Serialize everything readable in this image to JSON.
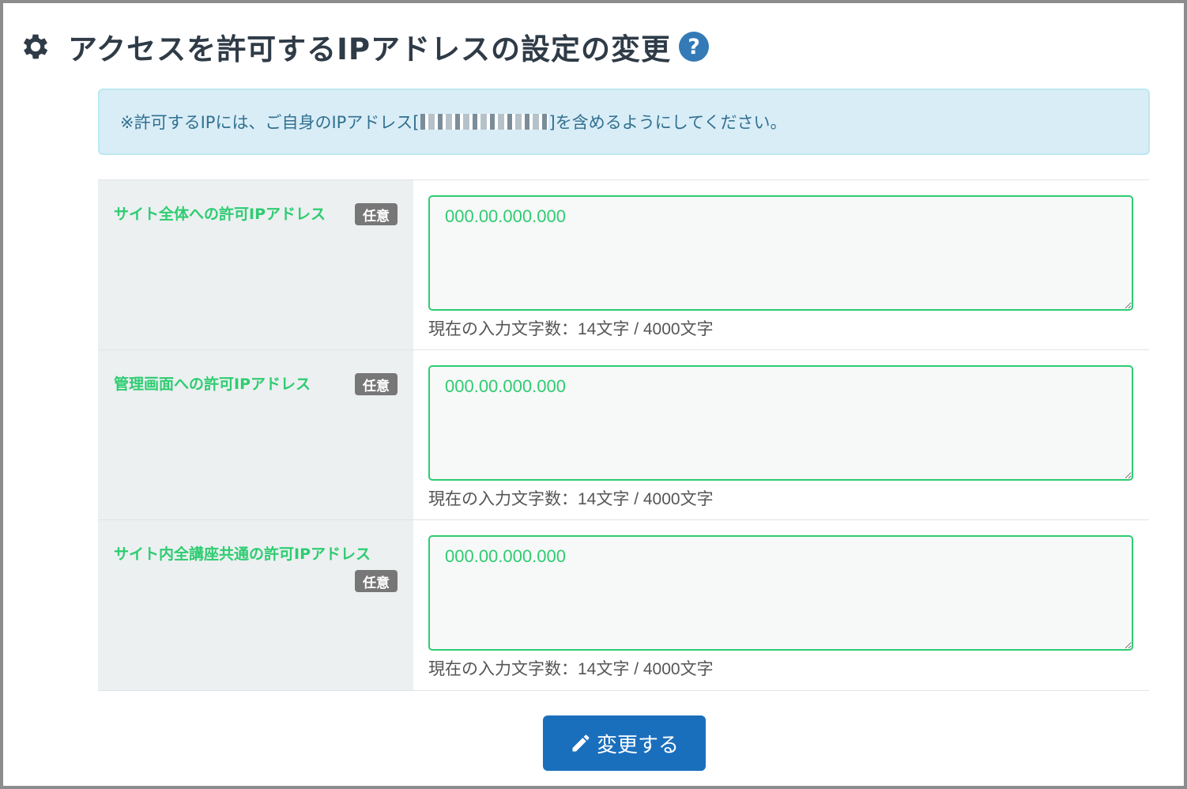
{
  "header": {
    "title": "アクセスを許可するIPアドレスの設定の変更",
    "gear_icon": "gear-icon",
    "help_icon": "question-circle-icon",
    "help_glyph": "?"
  },
  "notice": {
    "prefix": "※許可するIPには、ご自身のIPアドレス[",
    "suffix": "]を含めるようにしてください。"
  },
  "rows": [
    {
      "label": "サイト全体への許可IPアドレス",
      "badge": "任意",
      "value": "000.00.000.000",
      "count_text": "現在の入力文字数：14文字 / 4000文字"
    },
    {
      "label": "管理画面への許可IPアドレス",
      "badge": "任意",
      "value": "000.00.000.000",
      "count_text": "現在の入力文字数：14文字 / 4000文字"
    },
    {
      "label": "サイト内全講座共通の許可IPアドレス",
      "badge": "任意",
      "value": "000.00.000.000",
      "count_text": "現在の入力文字数：14文字 / 4000文字"
    }
  ],
  "submit": {
    "label": "変更する",
    "icon": "pencil-icon"
  },
  "colors": {
    "accent_green": "#2ecc71",
    "button_blue": "#1a6fbd",
    "notice_bg": "#d9edf7",
    "badge_gray": "#777777"
  }
}
